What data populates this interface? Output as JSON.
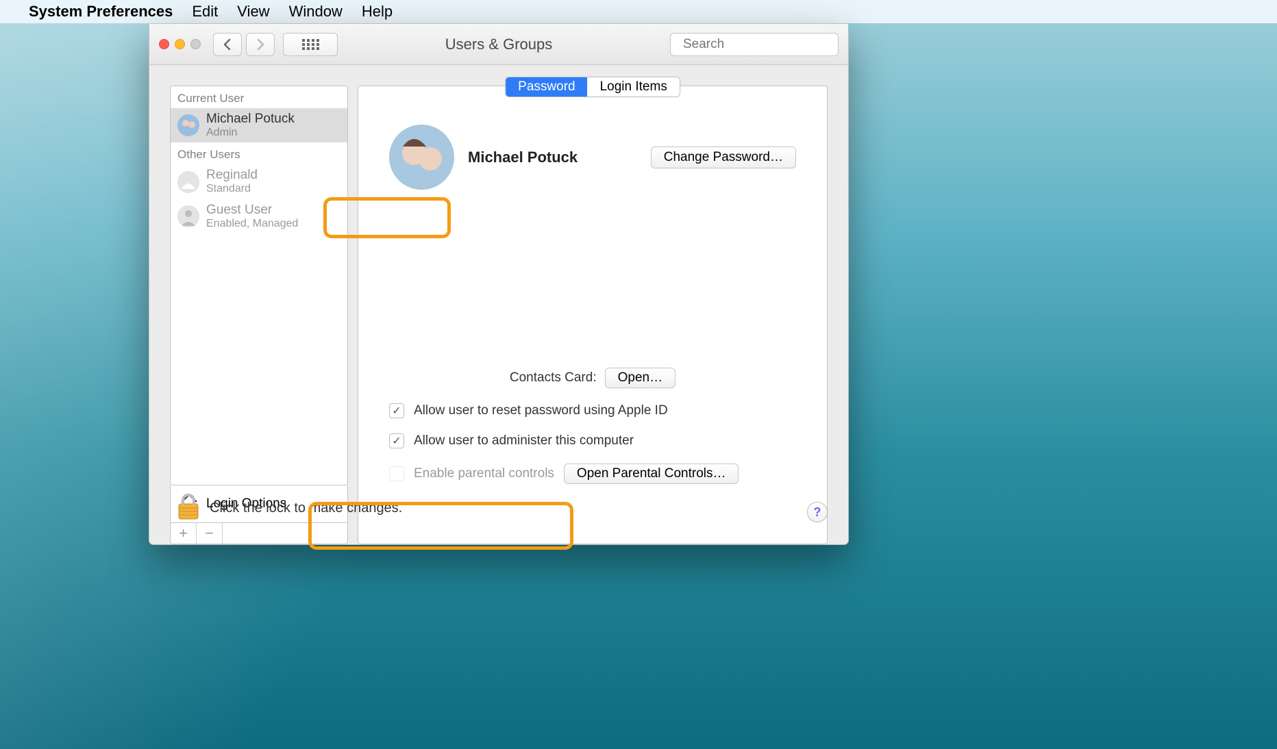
{
  "menubar": {
    "app_name": "System Preferences",
    "items": [
      "Edit",
      "View",
      "Window",
      "Help"
    ]
  },
  "window": {
    "title": "Users & Groups",
    "search_placeholder": "Search"
  },
  "tabs": {
    "password": "Password",
    "login_items": "Login Items"
  },
  "sidebar": {
    "section_current": "Current User",
    "section_other": "Other Users",
    "current": {
      "name": "Michael Potuck",
      "role": "Admin"
    },
    "others": [
      {
        "name": "Reginald",
        "role": "Standard"
      },
      {
        "name": "Guest User",
        "role": "Enabled, Managed"
      }
    ],
    "login_options": "Login Options"
  },
  "detail": {
    "user_name": "Michael Potuck",
    "change_password": "Change Password…",
    "contacts_label": "Contacts Card:",
    "open_label": "Open…",
    "allow_reset": "Allow user to reset password using Apple ID",
    "allow_admin": "Allow user to administer this computer",
    "parental_label": "Enable parental controls",
    "open_parental": "Open Parental Controls…"
  },
  "lock": {
    "text": "Click the lock to make changes."
  }
}
